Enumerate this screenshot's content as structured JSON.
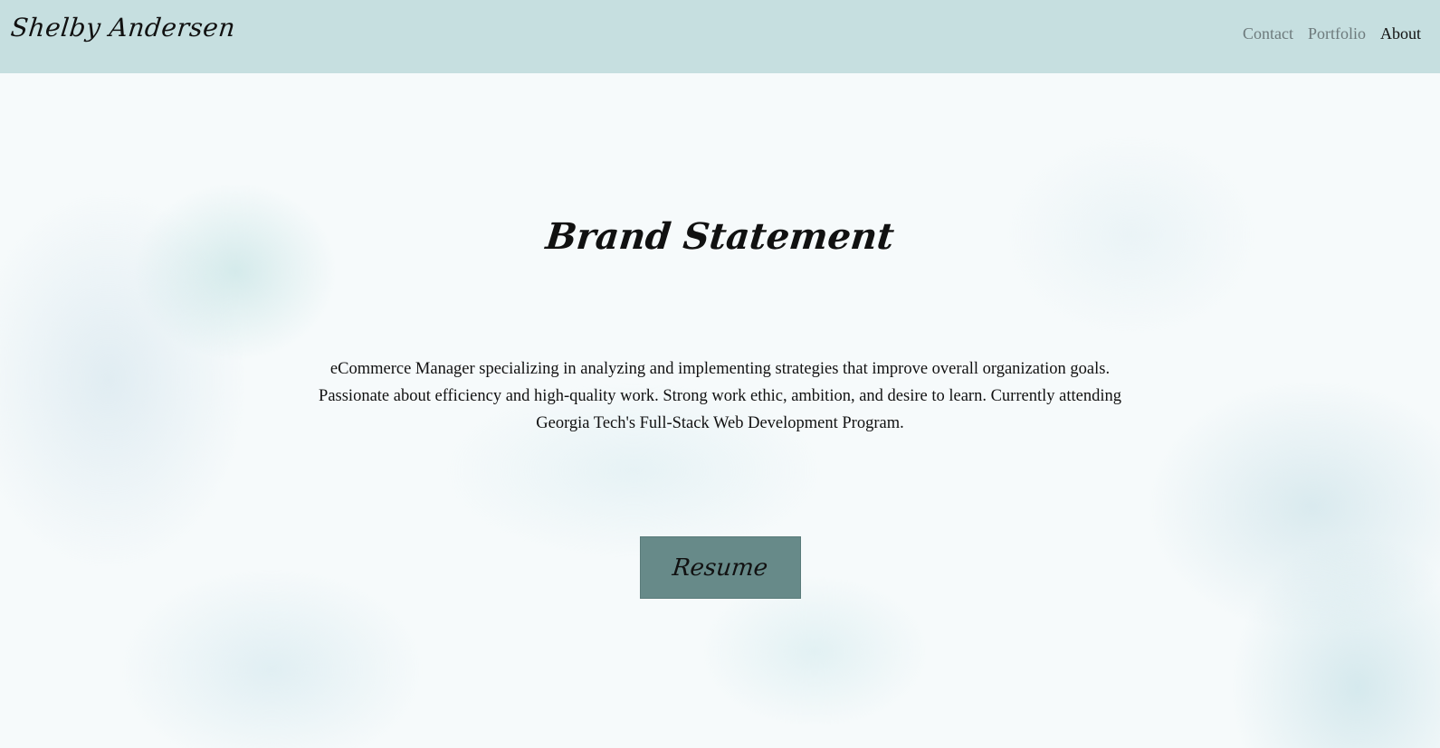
{
  "header": {
    "logo_text": "Shelby Andersen",
    "nav": {
      "contact": "Contact",
      "portfolio": "Portfolio",
      "about": "About"
    },
    "active_nav": "About"
  },
  "main": {
    "title": "Brand Statement",
    "statement": "eCommerce Manager specializing in analyzing and implementing strategies that improve overall organization goals. Passionate about efficiency and high-quality work. Strong work ethic, ambition, and desire to learn. Currently attending Georgia Tech's Full-Stack Web Development Program.",
    "resume_button": "Resume"
  },
  "colors": {
    "header_bg": "#c6dfe0",
    "button_bg": "#678a89",
    "nav_inactive": "#6d7a7c",
    "text": "#111111"
  }
}
